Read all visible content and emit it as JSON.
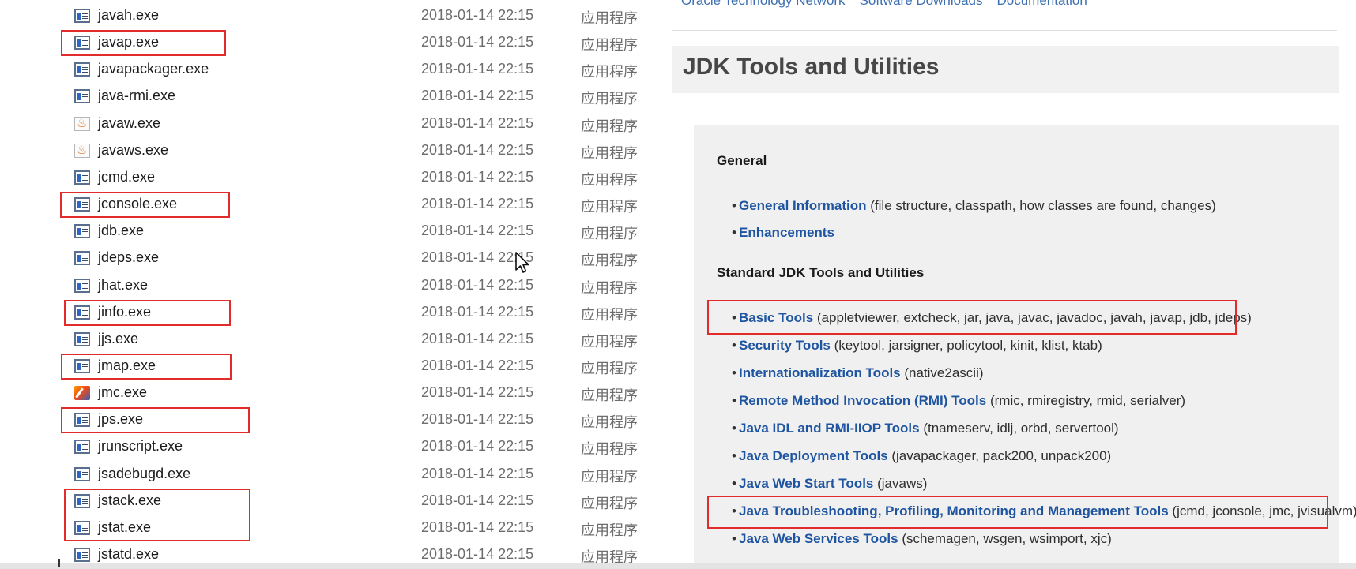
{
  "explorer": {
    "files": [
      {
        "name": "javah.exe",
        "date": "2018-01-14 22:15",
        "type": "应用程序",
        "icon": "exe-icon"
      },
      {
        "name": "javap.exe",
        "date": "2018-01-14 22:15",
        "type": "应用程序",
        "icon": "exe-icon"
      },
      {
        "name": "javapackager.exe",
        "date": "2018-01-14 22:15",
        "type": "应用程序",
        "icon": "exe-icon"
      },
      {
        "name": "java-rmi.exe",
        "date": "2018-01-14 22:15",
        "type": "应用程序",
        "icon": "exe-icon"
      },
      {
        "name": "javaw.exe",
        "date": "2018-01-14 22:15",
        "type": "应用程序",
        "icon": "java-cup-icon"
      },
      {
        "name": "javaws.exe",
        "date": "2018-01-14 22:15",
        "type": "应用程序",
        "icon": "java-cup-icon"
      },
      {
        "name": "jcmd.exe",
        "date": "2018-01-14 22:15",
        "type": "应用程序",
        "icon": "exe-icon"
      },
      {
        "name": "jconsole.exe",
        "date": "2018-01-14 22:15",
        "type": "应用程序",
        "icon": "exe-icon"
      },
      {
        "name": "jdb.exe",
        "date": "2018-01-14 22:15",
        "type": "应用程序",
        "icon": "exe-icon"
      },
      {
        "name": "jdeps.exe",
        "date": "2018-01-14 22:15",
        "type": "应用程序",
        "icon": "exe-icon"
      },
      {
        "name": "jhat.exe",
        "date": "2018-01-14 22:15",
        "type": "应用程序",
        "icon": "exe-icon"
      },
      {
        "name": "jinfo.exe",
        "date": "2018-01-14 22:15",
        "type": "应用程序",
        "icon": "exe-icon"
      },
      {
        "name": "jjs.exe",
        "date": "2018-01-14 22:15",
        "type": "应用程序",
        "icon": "exe-icon"
      },
      {
        "name": "jmap.exe",
        "date": "2018-01-14 22:15",
        "type": "应用程序",
        "icon": "exe-icon"
      },
      {
        "name": "jmc.exe",
        "date": "2018-01-14 22:15",
        "type": "应用程序",
        "icon": "jmc-icon"
      },
      {
        "name": "jps.exe",
        "date": "2018-01-14 22:15",
        "type": "应用程序",
        "icon": "exe-icon"
      },
      {
        "name": "jrunscript.exe",
        "date": "2018-01-14 22:15",
        "type": "应用程序",
        "icon": "exe-icon"
      },
      {
        "name": "jsadebugd.exe",
        "date": "2018-01-14 22:15",
        "type": "应用程序",
        "icon": "exe-icon"
      },
      {
        "name": "jstack.exe",
        "date": "2018-01-14 22:15",
        "type": "应用程序",
        "icon": "exe-icon"
      },
      {
        "name": "jstat.exe",
        "date": "2018-01-14 22:15",
        "type": "应用程序",
        "icon": "exe-icon"
      },
      {
        "name": "jstatd.exe",
        "date": "2018-01-14 22:15",
        "type": "应用程序",
        "icon": "exe-icon"
      }
    ],
    "highlighted": [
      "javap.exe",
      "jconsole.exe",
      "jinfo.exe",
      "jmap.exe",
      "jps.exe",
      "jstack.exe",
      "jstat.exe"
    ]
  },
  "doc": {
    "top_links": [
      "Oracle Technology Network",
      "Software Downloads",
      "Documentation"
    ],
    "title": "JDK Tools and Utilities",
    "sections": [
      {
        "heading": "General",
        "items": [
          {
            "link": "General Information",
            "desc": " (file structure, classpath, how classes are found, changes)"
          },
          {
            "link": "Enhancements",
            "desc": ""
          }
        ]
      },
      {
        "heading": "Standard JDK Tools and Utilities",
        "items": [
          {
            "link": "Basic Tools",
            "desc": " (appletviewer, extcheck, jar, java, javac, javadoc, javah, javap, jdb, jdeps)"
          },
          {
            "link": "Security Tools",
            "desc": " (keytool, jarsigner, policytool, kinit, klist, ktab)"
          },
          {
            "link": "Internationalization Tools",
            "desc": " (native2ascii)"
          },
          {
            "link": "Remote Method Invocation (RMI) Tools",
            "desc": " (rmic, rmiregistry, rmid, serialver)"
          },
          {
            "link": "Java IDL and RMI-IIOP Tools",
            "desc": " (tnameserv, idlj, orbd, servertool)"
          },
          {
            "link": "Java Deployment Tools",
            "desc": " (javapackager, pack200, unpack200)"
          },
          {
            "link": "Java Web Start Tools",
            "desc": " (javaws)"
          },
          {
            "link": "Java Troubleshooting, Profiling, Monitoring and Management Tools",
            "desc": " (jcmd, jconsole, jmc, jvisualvm)"
          },
          {
            "link": "Java Web Services Tools",
            "desc": " (schemagen, wsgen, wsimport, xjc)"
          }
        ]
      }
    ],
    "highlighted_items": [
      "Basic Tools",
      "Java Troubleshooting, Profiling, Monitoring and Management Tools"
    ]
  },
  "colors": {
    "highlight_box": "#e22b2b",
    "link": "#1f55a0",
    "title": "#474747"
  }
}
